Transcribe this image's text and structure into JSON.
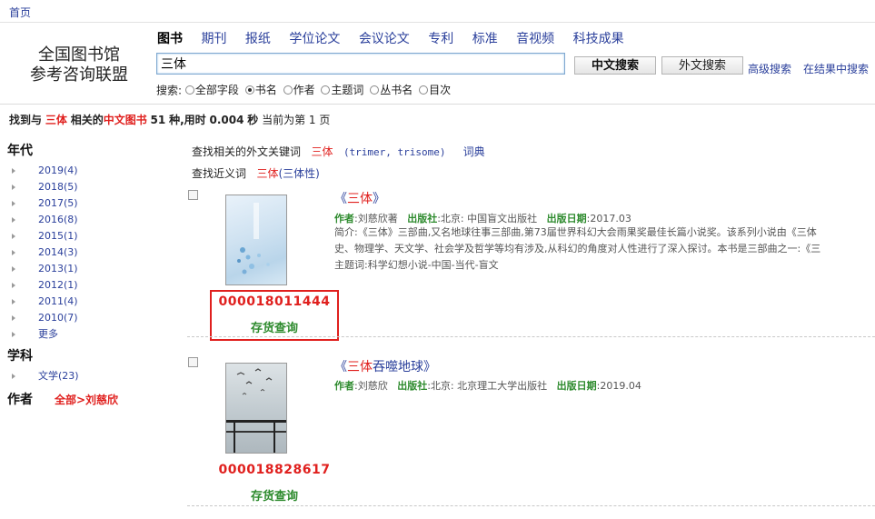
{
  "nav": {
    "home": "首页"
  },
  "logo": {
    "line1": "全国图书馆",
    "line2": "参考咨询联盟"
  },
  "tabs": [
    "图书",
    "期刊",
    "报纸",
    "学位论文",
    "会议论文",
    "专利",
    "标准",
    "音视频",
    "科技成果"
  ],
  "search": {
    "query": "三体",
    "cn_button": "中文搜索",
    "en_button": "外文搜索",
    "advanced": "高级搜索",
    "in_results": "在结果中搜索",
    "scope_label": "搜索:",
    "scopes": [
      "全部字段",
      "书名",
      "作者",
      "主题词",
      "丛书名",
      "目次"
    ],
    "selected_scope": "书名"
  },
  "summary": {
    "prefix": "找到与",
    "keyword": "三体",
    "mid": "相关的",
    "category": "中文图书",
    "count": "51",
    "suffix": "种,用时",
    "time": "0.004",
    "seconds": "秒",
    "page_text": "当前为第 1 页"
  },
  "sidebar": {
    "year_title": "年代",
    "years": [
      "2019(4)",
      "2018(5)",
      "2017(5)",
      "2016(8)",
      "2015(1)",
      "2014(3)",
      "2013(1)",
      "2012(1)",
      "2011(4)",
      "2010(7)",
      "更多"
    ],
    "subject_title": "学科",
    "subjects": [
      "文学(23)"
    ],
    "author_title": "作者",
    "author_value": "全部>刘慈欣"
  },
  "related": {
    "foreign_label": "查找相关的外文关键词",
    "foreign_kw": "三体",
    "foreign_terms": "(trimer, trisome)",
    "dict": "词典",
    "synonym_label": "查找近义词",
    "synonym_kw": "三体",
    "synonym_terms": "(三体性)"
  },
  "results": [
    {
      "title_open": "《",
      "title_hit": "三体",
      "title_rest": "",
      "title_close": "》",
      "author_label": "作者",
      "author": ":刘慈欣著",
      "publisher_label": "出版社",
      "publisher": ":北京: 中国盲文出版社",
      "date_label": "出版日期",
      "date": ":2017.03",
      "summary_line1": "简介:《三体》三部曲,又名地球往事三部曲,第73届世界科幻大会雨果奖最佳长篇小说奖。该系列小说由《三体",
      "summary_line2": "史、物理学、天文学、社会学及哲学等均有涉及,从科幻的角度对人性进行了深入探讨。本书是三部曲之一:《三",
      "subject_line": "主题词:科学幻想小说-中国-当代-盲文",
      "code": "000018011444",
      "stock": "存货查询"
    },
    {
      "title_open": "《",
      "title_hit": "三体",
      "title_rest": "吞噬地球",
      "title_close": "》",
      "author_label": "作者",
      "author": ":刘慈欣",
      "publisher_label": "出版社",
      "publisher": ":北京: 北京理工大学出版社",
      "date_label": "出版日期",
      "date": ":2019.04",
      "code": "000018828617",
      "stock": "存货查询"
    }
  ],
  "colors": {
    "accent_red": "#e0201e",
    "link_blue": "#2a3f9b",
    "label_green": "#2e8b2e"
  }
}
